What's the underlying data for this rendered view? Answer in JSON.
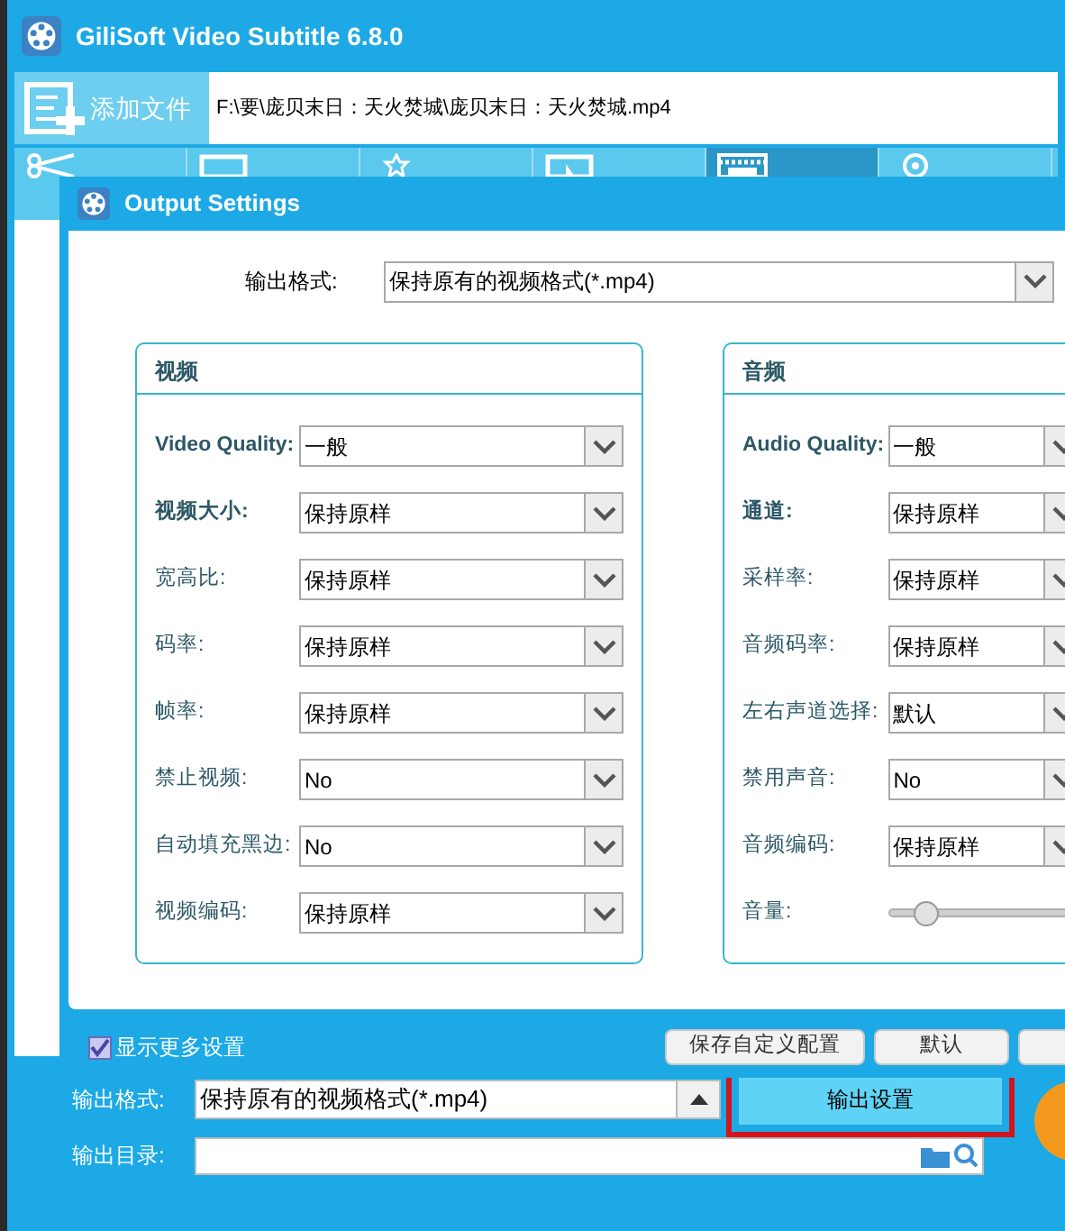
{
  "app": {
    "title": "GiliSoft Video Subtitle 6.8.0",
    "add_file_button": "添加文件",
    "file_path": "F:\\要\\庞贝末日：天火焚城\\庞贝末日：天火焚城.mp4"
  },
  "tabs": [
    {
      "kind": "scissors",
      "selected": false
    },
    {
      "kind": "crop",
      "selected": false
    },
    {
      "kind": "effects",
      "selected": false
    },
    {
      "kind": "watermark",
      "selected": false
    },
    {
      "kind": "subtitle",
      "selected": true
    },
    {
      "kind": "disc",
      "selected": false
    }
  ],
  "dialog": {
    "title": "Output Settings",
    "format_label": "输出格式:",
    "format_value": "保持原有的视频格式(*.mp4)",
    "video": {
      "title": "视频",
      "rows": [
        {
          "label": "Video Quality:",
          "value": "一般",
          "emphasized": true
        },
        {
          "label": "视频大小:",
          "value": "保持原样",
          "emphasized": true
        },
        {
          "label": "宽高比:",
          "value": "保持原样",
          "emphasized": false
        },
        {
          "label": "码率:",
          "value": "保持原样",
          "emphasized": false
        },
        {
          "label": "帧率:",
          "value": "保持原样",
          "emphasized": false
        },
        {
          "label": "禁止视频:",
          "value": "No",
          "emphasized": false
        },
        {
          "label": "自动填充黑边:",
          "value": "No",
          "emphasized": false
        },
        {
          "label": "视频编码:",
          "value": "保持原样",
          "emphasized": false
        }
      ]
    },
    "audio": {
      "title": "音频",
      "rows": [
        {
          "kind": "select",
          "label": "Audio Quality:",
          "value": "一般",
          "emphasized": true
        },
        {
          "kind": "select",
          "label": "通道:",
          "value": "保持原样",
          "emphasized": true
        },
        {
          "kind": "select",
          "label": "采样率:",
          "value": "保持原样",
          "emphasized": false
        },
        {
          "kind": "select",
          "label": "音频码率:",
          "value": "保持原样",
          "emphasized": false
        },
        {
          "kind": "select",
          "label": "左右声道选择:",
          "value": "默认",
          "emphasized": false
        },
        {
          "kind": "select",
          "label": "禁用声音:",
          "value": "No",
          "emphasized": false
        },
        {
          "kind": "select",
          "label": "音频编码:",
          "value": "保持原样",
          "emphasized": false
        },
        {
          "kind": "slider",
          "label": "音量:",
          "level": 0.2,
          "emphasized": false
        }
      ]
    },
    "more_settings": {
      "label": "显示更多设置",
      "checked": true
    },
    "buttons": [
      "保存自定义配置",
      "默认"
    ]
  },
  "output": {
    "format_label": "输出格式:",
    "format_value": "保持原有的视频格式(*.mp4)",
    "settings_button": "输出设置",
    "highlighted": true,
    "dir_label": "输出目录:"
  }
}
